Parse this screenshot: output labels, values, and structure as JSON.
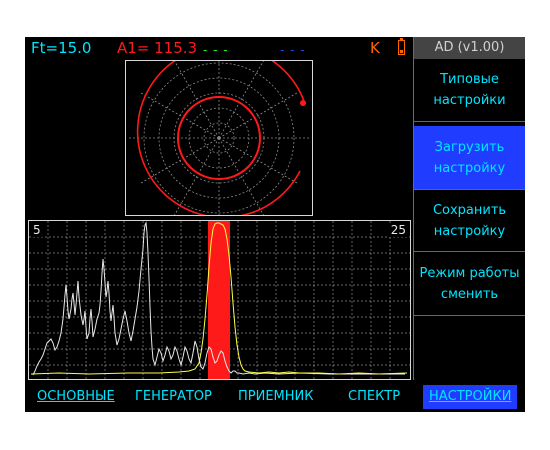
{
  "status": {
    "ft": "Ft=15.0",
    "a1": "A1= 115.3",
    "dashes_green": "- - -",
    "dashes_blue": "- - -",
    "k": "K"
  },
  "sidebar": {
    "version": "AD (v1.00)",
    "items": [
      {
        "lines": [
          "Типовые",
          "настройки"
        ]
      },
      {
        "lines": [
          "Загрузить",
          "настройку"
        ],
        "active": true
      },
      {
        "lines": [
          "Сохранить",
          "настройку"
        ]
      },
      {
        "lines": [
          "Режим работы",
          "сменить"
        ]
      }
    ]
  },
  "scan": {
    "min_label": "5",
    "max_label": "25"
  },
  "tabs": [
    "ОСНОВНЫЕ",
    "ГЕНЕРАТОР",
    "ПРИЕМНИК",
    "СПЕКТР",
    "НАСТРОЙКИ"
  ],
  "colors": {
    "cyan": "#00e5ff",
    "red": "#ff1a1a",
    "blue_active": "#1f3cff",
    "orange": "#ff6600",
    "trace_yellow": "#ffff44",
    "trace_white": "#e8e8e8"
  }
}
